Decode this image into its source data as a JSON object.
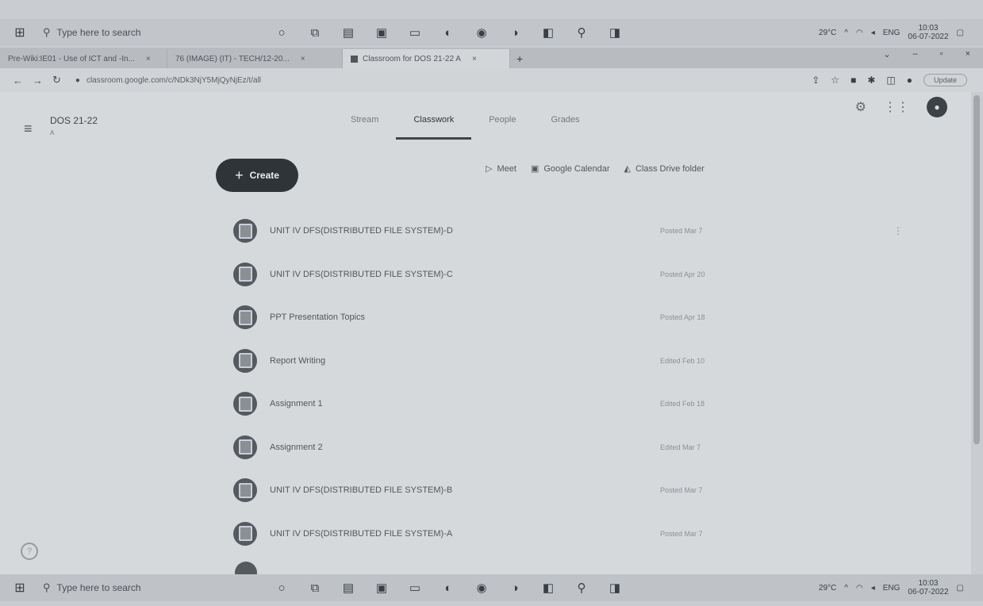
{
  "taskbar_top": {
    "search_placeholder": "Type here to search",
    "weather": "29°C",
    "language": "ENG",
    "time": "10:03",
    "date": "06-07-2022"
  },
  "browser": {
    "tabs": [
      {
        "label": "Pre-Wiki:IE01 - Use of ICT and -In..."
      },
      {
        "label": "76 (IMAGE) (IT) - TECH/12-20..."
      },
      {
        "label": "Classroom for DOS 21-22 A",
        "active": true
      }
    ],
    "new_tab": "+",
    "url": "classroom.google.com/c/NDk3NjY5MjQyNjEz/t/all",
    "profile_pill": "Update"
  },
  "classroom": {
    "class_name": "DOS 21-22",
    "class_section": "A",
    "tabs": [
      "Stream",
      "Classwork",
      "People",
      "Grades"
    ],
    "create_label": "Create",
    "actions": {
      "meet": "Meet",
      "calendar": "Google Calendar",
      "drive": "Class Drive folder"
    },
    "items": [
      {
        "title": "UNIT IV DFS(DISTRIBUTED FILE SYSTEM)-D",
        "date": "Posted Mar 7"
      },
      {
        "title": "UNIT IV DFS(DISTRIBUTED FILE SYSTEM)-C",
        "date": "Posted Apr 20"
      },
      {
        "title": "PPT Presentation Topics",
        "date": "Posted Apr 18"
      },
      {
        "title": "Report Writing",
        "date": "Edited Feb 10"
      },
      {
        "title": "Assignment 1",
        "date": "Edited Feb 18"
      },
      {
        "title": "Assignment 2",
        "date": "Edited Mar 7"
      },
      {
        "title": "UNIT IV DFS(DISTRIBUTED FILE SYSTEM)-B",
        "date": "Posted Mar 7"
      },
      {
        "title": "UNIT IV DFS(DISTRIBUTED FILE SYSTEM)-A",
        "date": "Posted Mar 7"
      }
    ]
  },
  "taskbar_bottom": {
    "search_placeholder": "Type here to search",
    "weather": "29°C",
    "language": "ENG",
    "time": "10:03",
    "date": "06-07-2022"
  }
}
